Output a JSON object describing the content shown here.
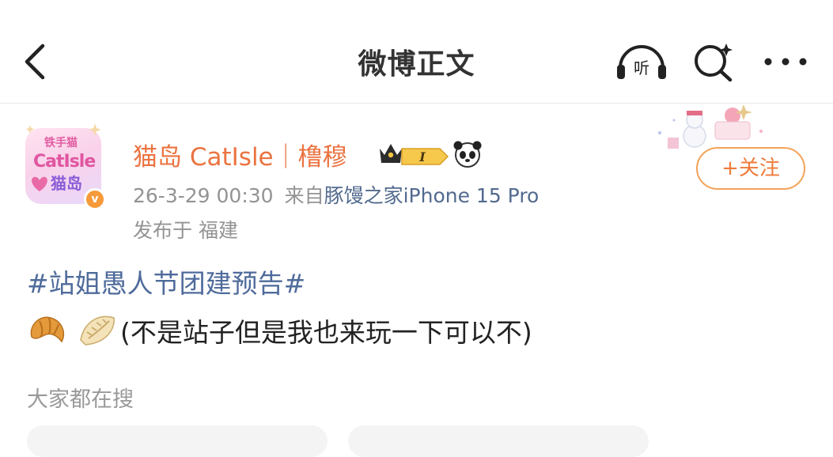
{
  "header": {
    "title": "微博正文",
    "back_icon": "chevron-left-icon",
    "listen_label": "听",
    "search_icon": "search-sparkle-icon",
    "more_icon": "more-dots-icon"
  },
  "post": {
    "avatar": {
      "line_top": "铁手猫",
      "line1": "CatIsle",
      "line2": "猫岛"
    },
    "verified_badge": "v",
    "username": "猫岛 CatIsle｜橹穆",
    "badges": {
      "crown": "crown-icon",
      "level": "I",
      "panda": "panda-icon"
    },
    "timestamp": "26-3-29 00:30",
    "source_prefix": "来自",
    "device": "豚馒之家iPhone 15 Pro",
    "location": "发布于 福建",
    "follow_label": "+关注",
    "topic": "#站姐愚人节团建预告#",
    "emojis": [
      "croissant-icon",
      "dumpling-icon"
    ],
    "text": "(不是站子但是我也来玩一下可以不)"
  },
  "related": {
    "title": "大家都在搜"
  },
  "colors": {
    "username": "#eb7340",
    "topic": "#4f6b9b",
    "meta": "#939393",
    "follow": "#ee7b3a"
  }
}
